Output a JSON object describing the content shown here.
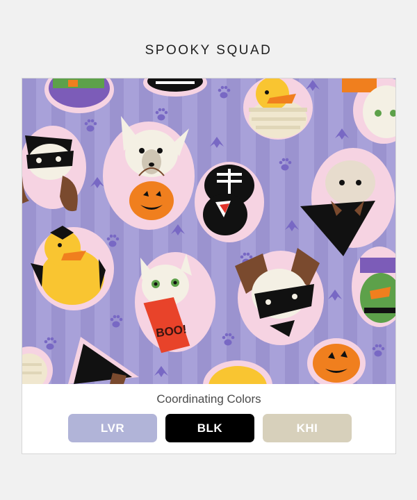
{
  "page": {
    "title": "SPOOKY SQUAD"
  },
  "pattern": {
    "bag_text": "BOO!",
    "colors": {
      "background": "#a7a0d8",
      "stripe": "#9a92cf",
      "paw": "#7d6ec7",
      "sticker_border": "#f3c9dc",
      "orange": "#f07f1e",
      "yellow": "#f9c531",
      "black": "#111111",
      "brown": "#7a4a2e"
    }
  },
  "coordinating": {
    "heading": "Coordinating Colors",
    "swatches": [
      {
        "code": "LVR",
        "color": "#b1b4d8"
      },
      {
        "code": "BLK",
        "color": "#000000"
      },
      {
        "code": "KHI",
        "color": "#d7d0bb"
      }
    ]
  }
}
